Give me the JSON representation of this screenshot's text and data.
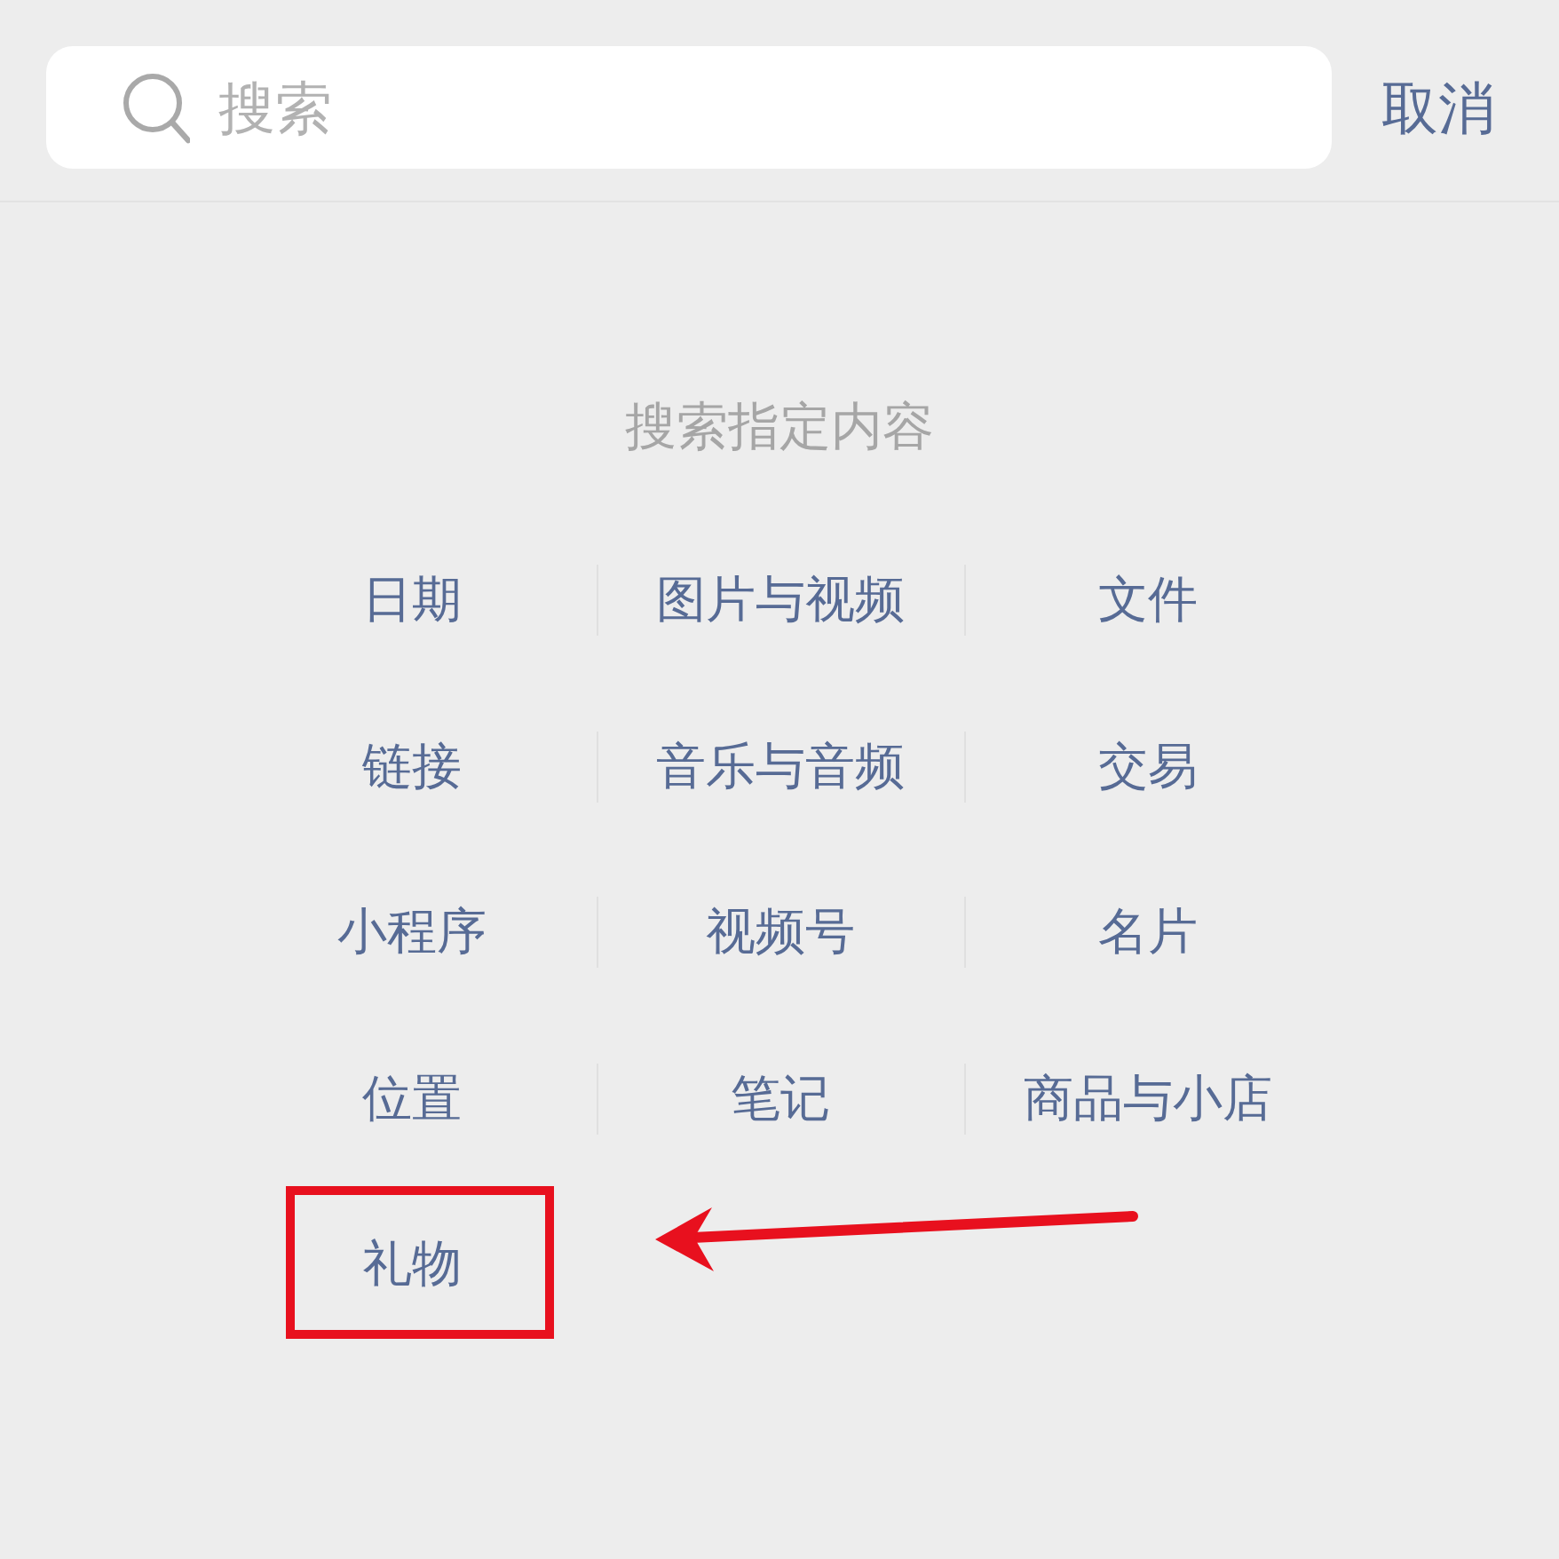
{
  "search": {
    "placeholder": "搜索"
  },
  "cancel": "取消",
  "section": {
    "title": "搜索指定内容",
    "items": [
      {
        "label": "日期",
        "highlighted": false
      },
      {
        "label": "图片与视频",
        "highlighted": false
      },
      {
        "label": "文件",
        "highlighted": false
      },
      {
        "label": "链接",
        "highlighted": false
      },
      {
        "label": "音乐与音频",
        "highlighted": false
      },
      {
        "label": "交易",
        "highlighted": false
      },
      {
        "label": "小程序",
        "highlighted": false
      },
      {
        "label": "视频号",
        "highlighted": false
      },
      {
        "label": "名片",
        "highlighted": false
      },
      {
        "label": "位置",
        "highlighted": false
      },
      {
        "label": "笔记",
        "highlighted": false
      },
      {
        "label": "商品与小店",
        "highlighted": false
      },
      {
        "label": "礼物",
        "highlighted": true
      }
    ]
  }
}
